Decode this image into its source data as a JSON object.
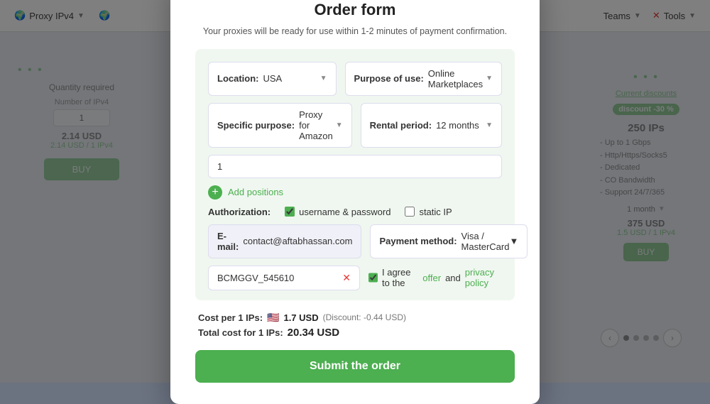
{
  "page": {
    "title": "Order form"
  },
  "nav": {
    "proxy_ipv4": "Proxy IPv4",
    "tools": "Tools",
    "teams": "Teams"
  },
  "background": {
    "current_discounts": "Current discounts",
    "discount_badge": "discount -30 %",
    "ips_count": "250 IPs",
    "features": [
      "- Up to 1 Gbps",
      "- Http/Https/Socks5",
      "- Dedicated",
      "- CO Bandwidth",
      "- Support 24/7/365"
    ],
    "period": "1 month",
    "price": "375 USD",
    "price_per": "1.5 USD / 1 IPv4",
    "buy_label": "BUY",
    "quantity_required": "Quantity required",
    "number_label": "Number of IPv4",
    "quantity_value": "1",
    "cost_usd": "2.14 USD",
    "cost_per": "2.14 USD / 1 IPv4",
    "buy_left_label": "BUY"
  },
  "modal": {
    "title": "Order form",
    "subtitle": "Your proxies will be ready for use within 1-2 minutes of payment confirmation.",
    "close_label": "×",
    "location_label": "Location:",
    "location_value": "USA",
    "purpose_label": "Purpose of use:",
    "purpose_value": "Online Marketplaces",
    "specific_label": "Specific purpose:",
    "specific_value": "Proxy for Amazon",
    "rental_label": "Rental period:",
    "rental_value": "12 months",
    "quantity_placeholder": "1",
    "add_positions_label": "Add positions",
    "auth_label": "Authorization:",
    "auth_username": "username & password",
    "auth_static_ip": "static IP",
    "email_label": "E-mail:",
    "email_value": "contact@aftabhassan.com",
    "payment_label": "Payment method:",
    "payment_value": "Visa / MasterCard",
    "promo_value": "BCMGGV_545610",
    "agree_text": "I agree to the",
    "offer_link": "offer",
    "and_text": "and",
    "privacy_link": "privacy policy",
    "cost_per_label": "Cost per 1 IPs:",
    "cost_per_amount": "1.7 USD",
    "cost_discount": "(Discount: -0.44 USD)",
    "total_label": "Total cost for 1 IPs:",
    "total_amount": "20.34 USD",
    "submit_label": "Submit the order"
  }
}
